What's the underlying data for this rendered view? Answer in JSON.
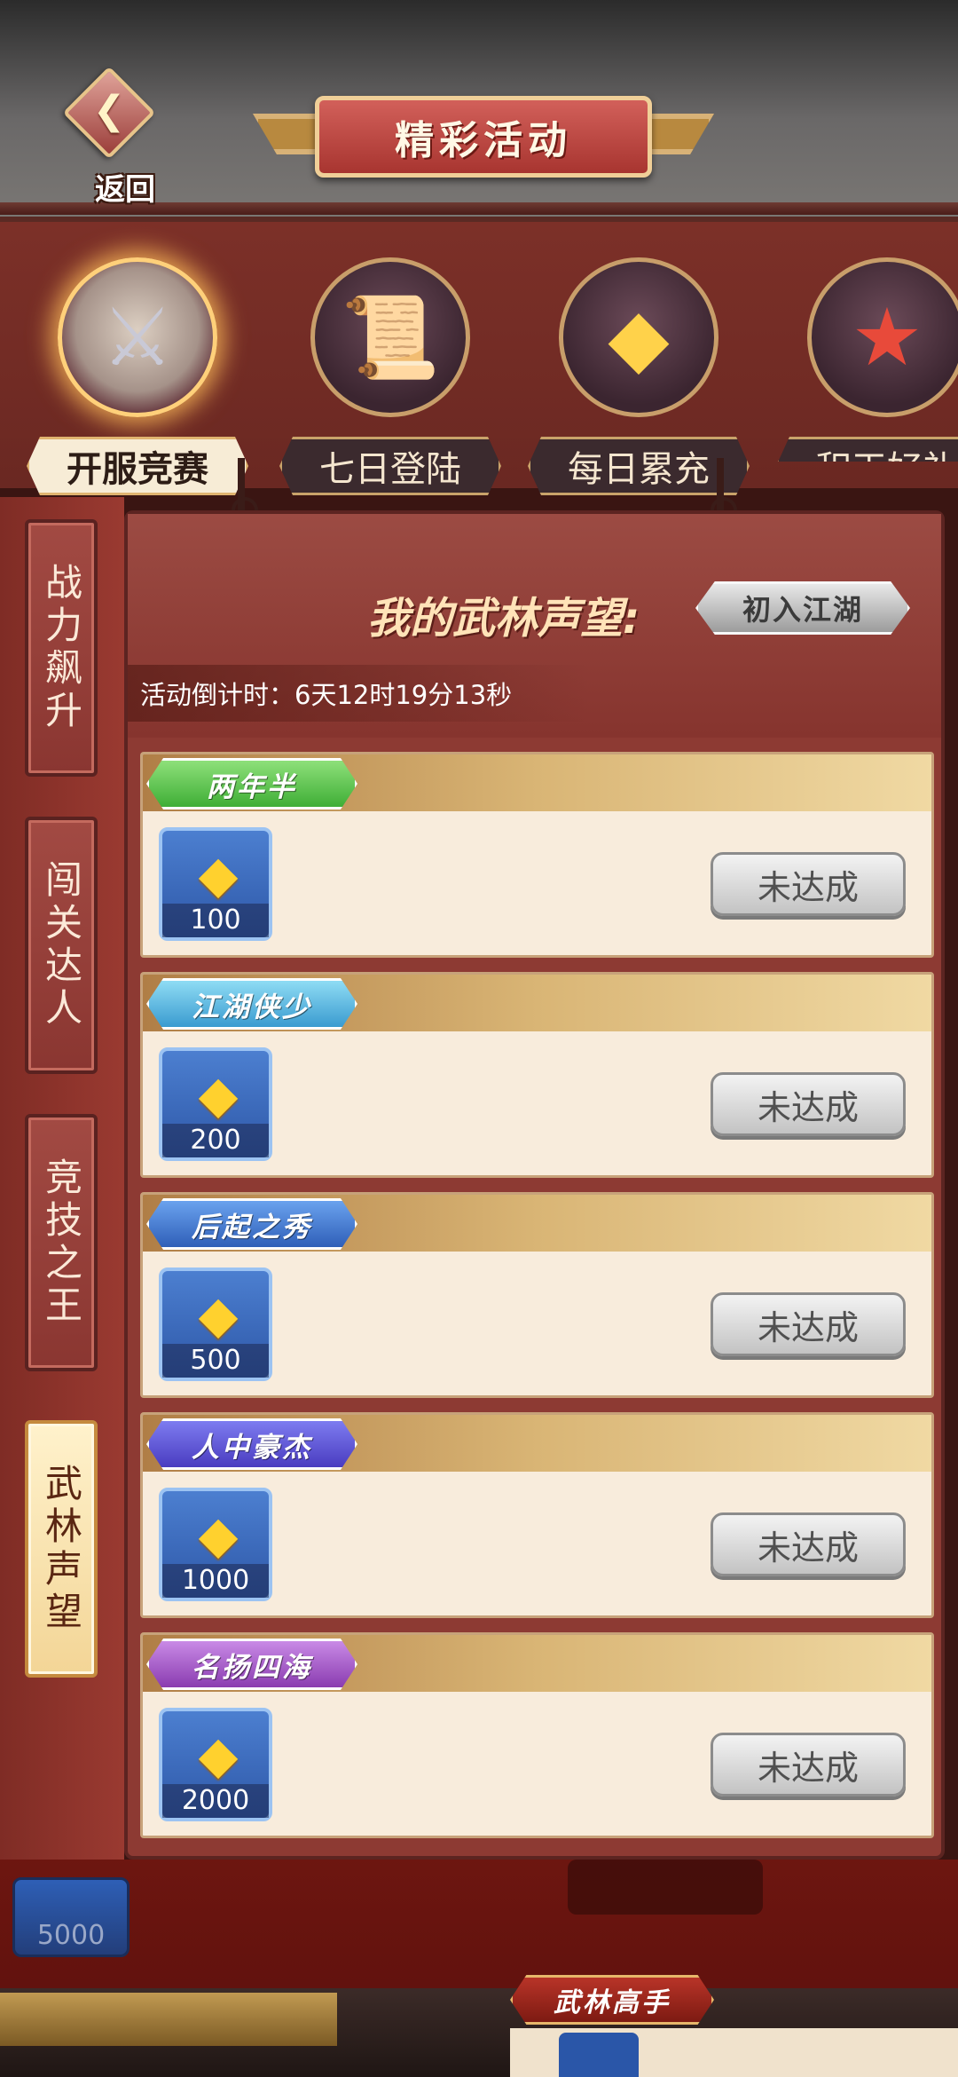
{
  "header": {
    "back_label": "返回",
    "title": "精彩活动"
  },
  "top_tabs": [
    {
      "label": "开服竞赛",
      "icon": "crossed-swords-icon",
      "active": true
    },
    {
      "label": "七日登陆",
      "icon": "scroll-gold-icon",
      "active": false
    },
    {
      "label": "每日累充",
      "icon": "gold-ingot-chest-icon",
      "active": false
    },
    {
      "label": "积天好礼",
      "icon": "treasure-pile-icon",
      "active": false
    }
  ],
  "side_tabs": [
    {
      "label": "战力飙升",
      "active": false
    },
    {
      "label": "闯关达人",
      "active": false
    },
    {
      "label": "竞技之王",
      "active": false
    },
    {
      "label": "武林声望",
      "active": true
    }
  ],
  "panel": {
    "reputation_label": "我的武林声望:",
    "reputation_value": "初入江湖",
    "countdown": "活动倒计时：6天12时19分13秒"
  },
  "rewards": [
    {
      "rank": "两年半",
      "amount": "100",
      "status": "未达成",
      "tag_color": "#5fc44a"
    },
    {
      "rank": "江湖侠少",
      "amount": "200",
      "status": "未达成",
      "tag_color": "#4aa7d8"
    },
    {
      "rank": "后起之秀",
      "amount": "500",
      "status": "未达成",
      "tag_color": "#3d72c8"
    },
    {
      "rank": "人中豪杰",
      "amount": "1000",
      "status": "未达成",
      "tag_color": "#5a4ad0"
    },
    {
      "rank": "名扬四海",
      "amount": "2000",
      "status": "未达成",
      "tag_color": "#9a4ab8"
    }
  ],
  "overlay_partial": {
    "amount": "5000",
    "rank": "武林高手"
  }
}
